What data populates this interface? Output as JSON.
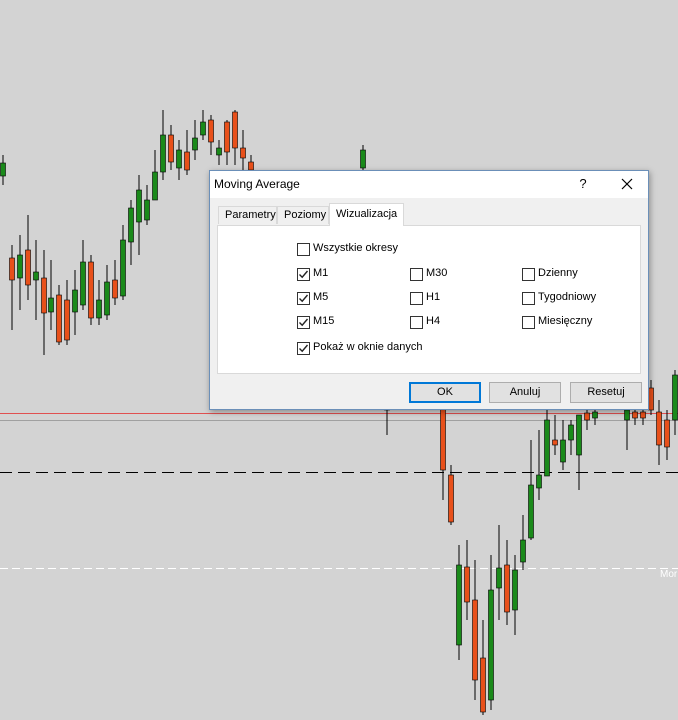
{
  "dialog": {
    "title": "Moving Average",
    "help_label": "?",
    "tabs": [
      {
        "label": "Parametry",
        "active": false
      },
      {
        "label": "Poziomy",
        "active": false
      },
      {
        "label": "Wizualizacja",
        "active": true
      }
    ],
    "checkboxes": {
      "all_periods": {
        "label": "Wszystkie okresy",
        "checked": false
      },
      "m1": {
        "label": "M1",
        "checked": true
      },
      "m5": {
        "label": "M5",
        "checked": true
      },
      "m15": {
        "label": "M15",
        "checked": true
      },
      "m30": {
        "label": "M30",
        "checked": false
      },
      "h1": {
        "label": "H1",
        "checked": false
      },
      "h4": {
        "label": "H4",
        "checked": false
      },
      "daily": {
        "label": "Dzienny",
        "checked": false
      },
      "weekly": {
        "label": "Tygodniowy",
        "checked": false
      },
      "monthly": {
        "label": "Miesięczny",
        "checked": false
      },
      "show_in_data_window": {
        "label": "Pokaż w oknie danych",
        "checked": true
      }
    },
    "buttons": {
      "ok": "OK",
      "cancel": "Anuluj",
      "reset": "Resetuj"
    }
  },
  "chart": {
    "background": "#d3d3d3",
    "bull_color": "#1a8a1a",
    "bear_color": "#e8501a",
    "wick_color": "#000000",
    "price_line_color": "#e05050",
    "label_fragment": "Mor"
  }
}
